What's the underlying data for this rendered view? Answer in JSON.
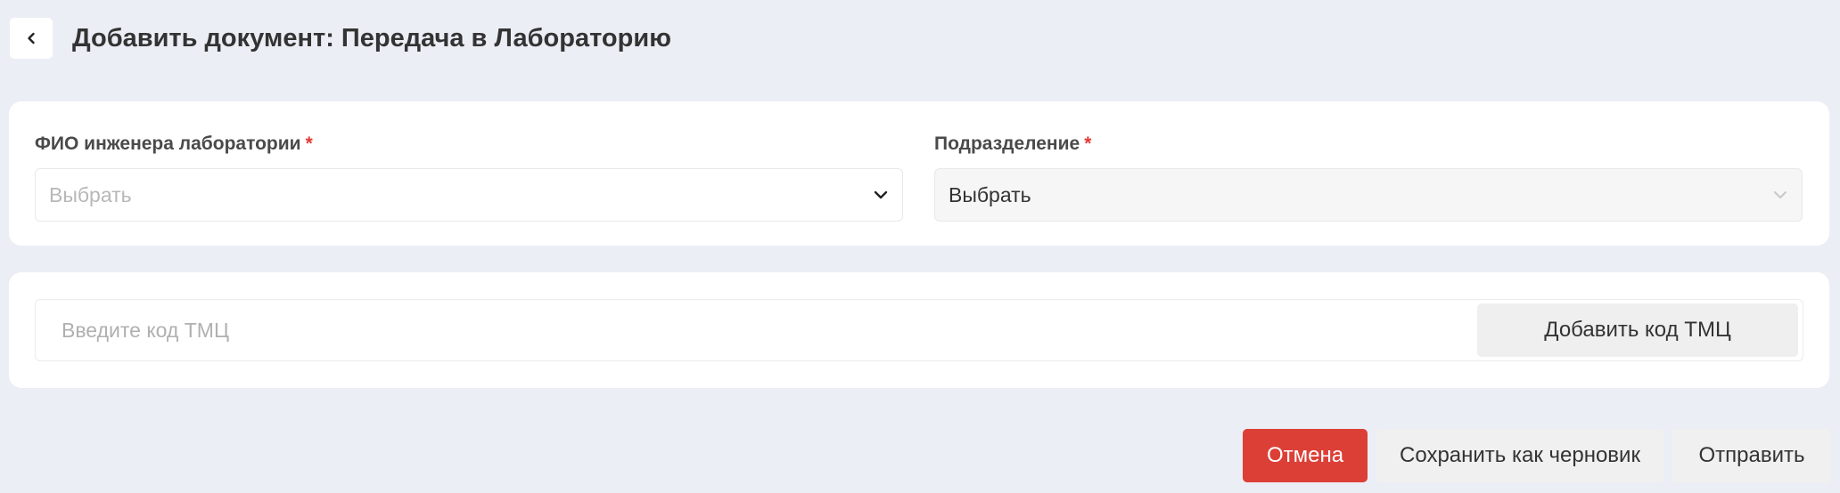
{
  "header": {
    "back_icon": "chevron-left-icon",
    "title": "Добавить документ: Передача в Лабораторию"
  },
  "form": {
    "engineer": {
      "label": "ФИО инженера лаборатории",
      "required_mark": "*",
      "value": "Выбрать",
      "is_placeholder": true,
      "icon": "chevron-down-icon"
    },
    "department": {
      "label": "Подразделение",
      "required_mark": "*",
      "value": "Выбрать",
      "disabled": true,
      "icon": "chevron-down-icon"
    }
  },
  "tmc": {
    "input_placeholder": "Введите код ТМЦ",
    "add_button_label": "Добавить код ТМЦ"
  },
  "actions": {
    "cancel_label": "Отмена",
    "draft_label": "Сохранить как черновик",
    "send_label": "Отправить"
  },
  "colors": {
    "background": "#ebeef5",
    "card": "#ffffff",
    "danger": "#dc3f36",
    "required": "#e53935"
  }
}
